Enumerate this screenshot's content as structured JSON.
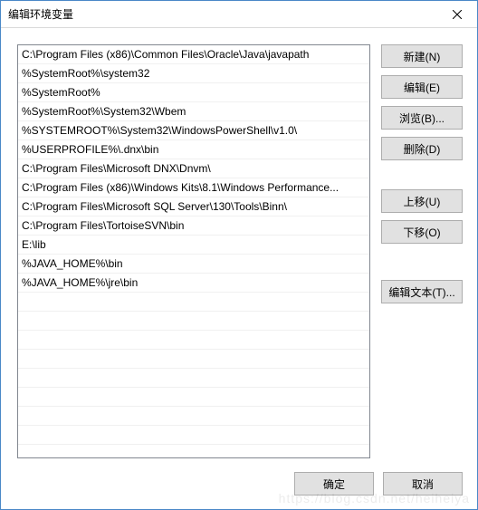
{
  "window": {
    "title": "编辑环境变量"
  },
  "paths": [
    "C:\\Program Files (x86)\\Common Files\\Oracle\\Java\\javapath",
    "%SystemRoot%\\system32",
    "%SystemRoot%",
    "%SystemRoot%\\System32\\Wbem",
    "%SYSTEMROOT%\\System32\\WindowsPowerShell\\v1.0\\",
    "%USERPROFILE%\\.dnx\\bin",
    "C:\\Program Files\\Microsoft DNX\\Dnvm\\",
    "C:\\Program Files (x86)\\Windows Kits\\8.1\\Windows Performance...",
    "C:\\Program Files\\Microsoft SQL Server\\130\\Tools\\Binn\\",
    "C:\\Program Files\\TortoiseSVN\\bin",
    "E:\\lib",
    "%JAVA_HOME%\\bin",
    "%JAVA_HOME%\\jre\\bin"
  ],
  "buttons": {
    "new": "新建(N)",
    "edit": "编辑(E)",
    "browse": "浏览(B)...",
    "delete": "删除(D)",
    "moveUp": "上移(U)",
    "moveDown": "下移(O)",
    "editText": "编辑文本(T)...",
    "ok": "确定",
    "cancel": "取消"
  },
  "watermark": "https://blog.csdn.net/heiheiya"
}
